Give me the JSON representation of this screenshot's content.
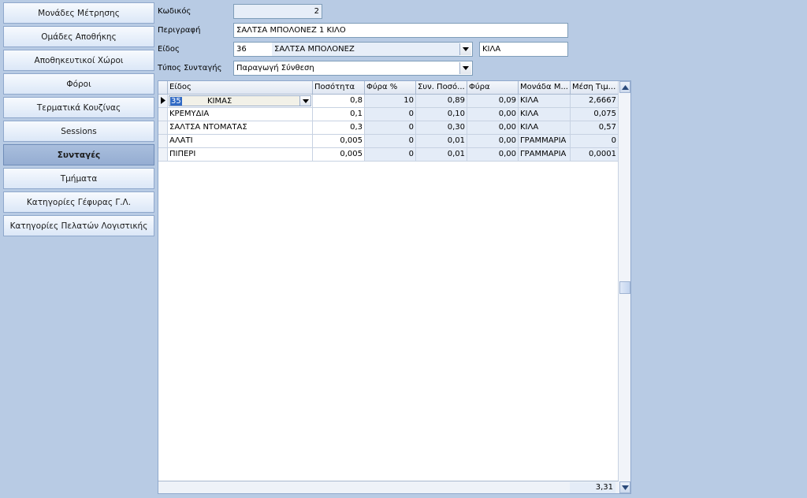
{
  "sidebar": {
    "items": [
      {
        "label": "Μονάδες Μέτρησης"
      },
      {
        "label": "Ομάδες Αποθήκης"
      },
      {
        "label": "Αποθηκευτικοί Χώροι"
      },
      {
        "label": "Φόροι"
      },
      {
        "label": "Τερματικά Κουζίνας"
      },
      {
        "label": "Sessions"
      },
      {
        "label": "Συνταγές"
      },
      {
        "label": "Τμήματα"
      },
      {
        "label": "Κατηγορίες Γέφυρας Γ.Λ."
      },
      {
        "label": "Κατηγορίες Πελατών Λογιστικής"
      }
    ],
    "active_index": 6
  },
  "form": {
    "code_label": "Κωδικός",
    "code_value": "2",
    "description_label": "Περιγραφή",
    "description_value": "ΣΑΛΤΣΑ ΜΠΟΛΟΝΕΖ 1 ΚΙΛΟ",
    "item_label": "Είδος",
    "item_code": "36",
    "item_name": "ΣΑΛΤΣΑ ΜΠΟΛΟΝΕΖ",
    "item_unit": "ΚΙΛΑ",
    "recipe_type_label": "Τύπος Συνταγής",
    "recipe_type_value": "Παραγωγή Σύνθεση"
  },
  "grid": {
    "columns": [
      "Είδος",
      "Ποσότητα",
      "Φύρα %",
      "Συν. Ποσό...",
      "Φύρα",
      "Μονάδα Μ...",
      "Μέση Τιμ..."
    ],
    "editing_row": {
      "code": "35",
      "name": "ΚΙΜΑΣ"
    },
    "rows": [
      {
        "item": "ΚΙΜΑΣ",
        "qty": "0,8",
        "waste_pct": "10",
        "total_qty": "0,89",
        "waste": "0,09",
        "unit": "ΚΙΛΑ",
        "avg_price": "2,6667"
      },
      {
        "item": "ΚΡΕΜΥΔΙΑ",
        "qty": "0,1",
        "waste_pct": "0",
        "total_qty": "0,10",
        "waste": "0,00",
        "unit": "ΚΙΛΑ",
        "avg_price": "0,075"
      },
      {
        "item": "ΣΑΛΤΣΑ ΝΤΟΜΑΤΑΣ",
        "qty": "0,3",
        "waste_pct": "0",
        "total_qty": "0,30",
        "waste": "0,00",
        "unit": "ΚΙΛΑ",
        "avg_price": "0,57"
      },
      {
        "item": "ΑΛΑΤΙ",
        "qty": "0,005",
        "waste_pct": "0",
        "total_qty": "0,01",
        "waste": "0,00",
        "unit": "ΓΡΑΜΜΑΡΙΑ",
        "avg_price": "0"
      },
      {
        "item": "ΠΙΠΕΡΙ",
        "qty": "0,005",
        "waste_pct": "0",
        "total_qty": "0,01",
        "waste": "0,00",
        "unit": "ΓΡΑΜΜΑΡΙΑ",
        "avg_price": "0,0001"
      }
    ],
    "footer_total": "3,31"
  },
  "icons": {
    "combo": "chevron-down-icon",
    "row_pointer": "row-pointer-icon",
    "scroll_up": "scroll-up-icon",
    "scroll_down": "scroll-down-icon"
  },
  "colors": {
    "background": "#b8cbe4",
    "active_nav": "#a9bedd",
    "readonly_cell": "#e4ecf7",
    "selection": "#316ac5"
  }
}
